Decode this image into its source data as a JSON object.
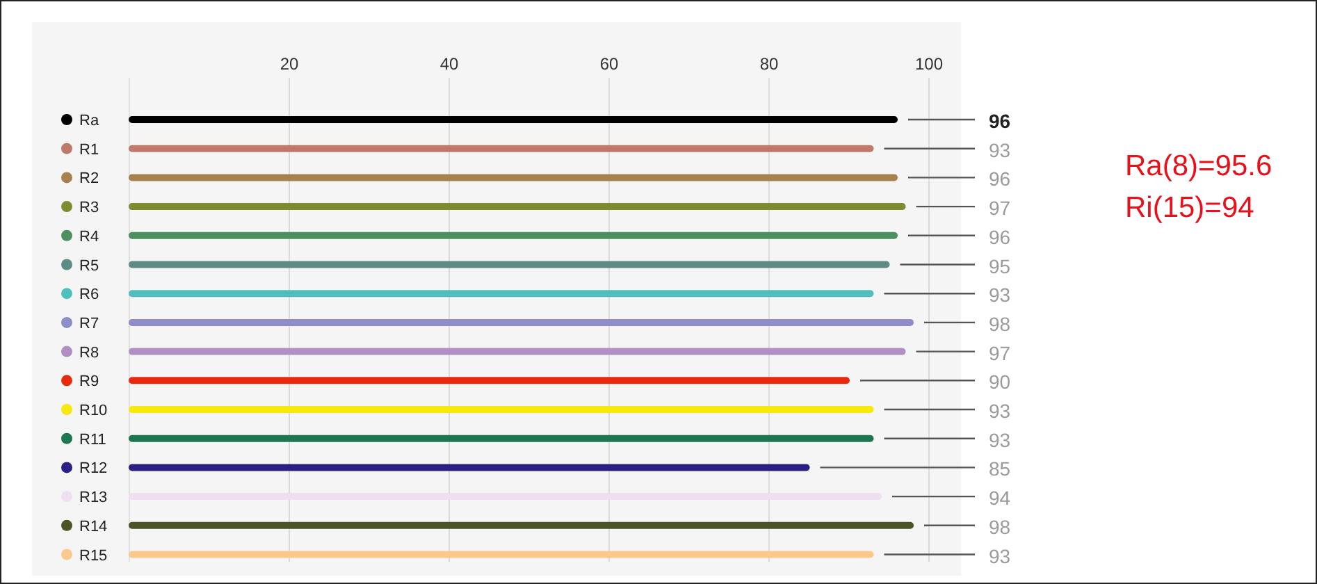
{
  "chart": {
    "chart_data": {
      "type": "bar",
      "orientation": "horizontal",
      "categories": [
        "Ra",
        "R1",
        "R2",
        "R3",
        "R4",
        "R5",
        "R6",
        "R7",
        "R8",
        "R9",
        "R10",
        "R11",
        "R12",
        "R13",
        "R14",
        "R15"
      ],
      "series": [
        {
          "values": [
            96,
            93,
            96,
            97,
            96,
            95,
            93,
            98,
            97,
            90,
            93,
            93,
            85,
            94,
            98,
            93
          ]
        }
      ],
      "colors": [
        "#000000",
        "#c07a6a",
        "#a98150",
        "#7f8b30",
        "#4e8f5f",
        "#5f8a86",
        "#4fbfbd",
        "#8e8cc9",
        "#b08fc4",
        "#e8290f",
        "#f7e90e",
        "#1a7752",
        "#2a1f82",
        "#efdff0",
        "#4a5426",
        "#fbc98e"
      ],
      "xlim": [
        0,
        100
      ],
      "xticks": [
        20,
        40,
        60,
        80,
        100
      ],
      "grid": true,
      "data_labels": true
    },
    "bold_value_labels": [
      true,
      false,
      false,
      false,
      false,
      false,
      false,
      false,
      false,
      false,
      false,
      false,
      false,
      false,
      false,
      false
    ]
  },
  "summary": [
    "Ra(8)=95.6",
    "Ri(15)=94"
  ]
}
